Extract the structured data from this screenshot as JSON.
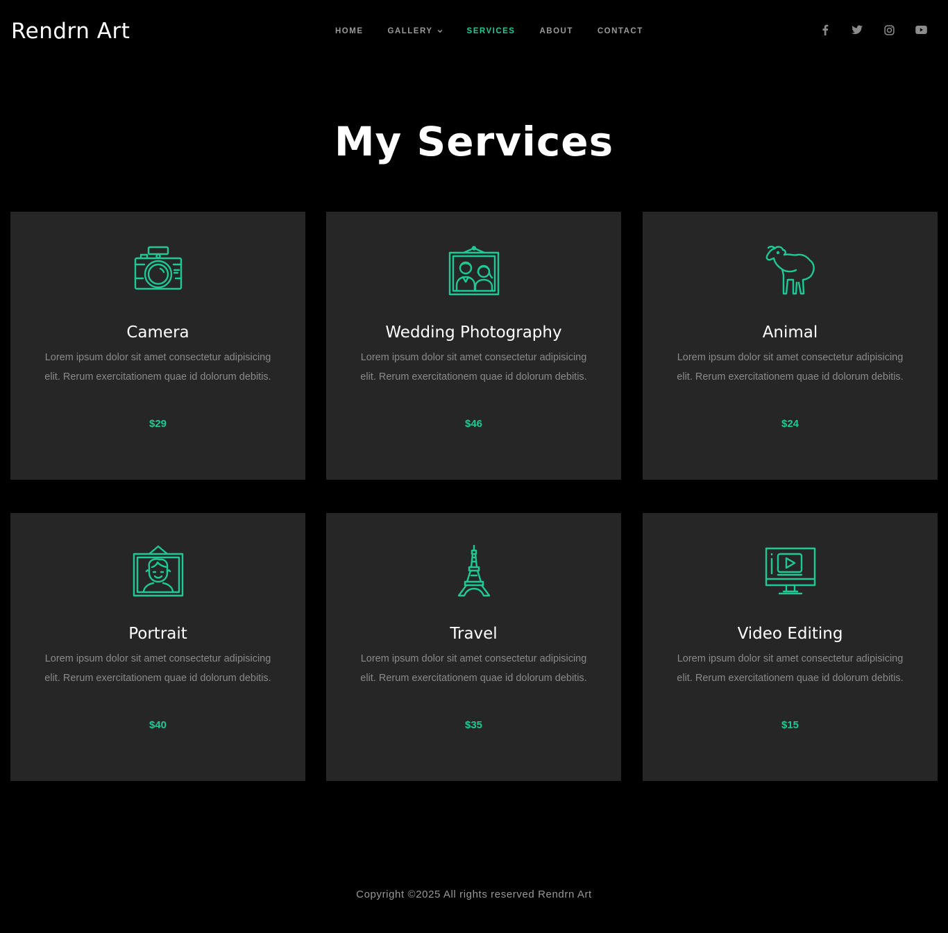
{
  "header": {
    "logo": "Rendrn Art",
    "nav": [
      {
        "label": "HOME",
        "active": false,
        "dropdown": false
      },
      {
        "label": "GALLERY",
        "active": false,
        "dropdown": true
      },
      {
        "label": "SERVICES",
        "active": true,
        "dropdown": false
      },
      {
        "label": "ABOUT",
        "active": false,
        "dropdown": false
      },
      {
        "label": "CONTACT",
        "active": false,
        "dropdown": false
      }
    ],
    "social": [
      "facebook-icon",
      "twitter-icon",
      "instagram-icon",
      "youtube-icon"
    ]
  },
  "main": {
    "title": "My Services",
    "services": [
      {
        "icon": "camera-icon",
        "title": "Camera",
        "desc": "Lorem ipsum dolor sit amet consectetur adipisicing elit. Rerum exercitationem quae id dolorum debitis.",
        "price": "$29"
      },
      {
        "icon": "wedding-photo-icon",
        "title": "Wedding Photography",
        "desc": "Lorem ipsum dolor sit amet consectetur adipisicing elit. Rerum exercitationem quae id dolorum debitis.",
        "price": "$46"
      },
      {
        "icon": "sheep-icon",
        "title": "Animal",
        "desc": "Lorem ipsum dolor sit amet consectetur adipisicing elit. Rerum exercitationem quae id dolorum debitis.",
        "price": "$24"
      },
      {
        "icon": "portrait-frame-icon",
        "title": "Portrait",
        "desc": "Lorem ipsum dolor sit amet consectetur adipisicing elit. Rerum exercitationem quae id dolorum debitis.",
        "price": "$40"
      },
      {
        "icon": "eiffel-tower-icon",
        "title": "Travel",
        "desc": "Lorem ipsum dolor sit amet consectetur adipisicing elit. Rerum exercitationem quae id dolorum debitis.",
        "price": "$35"
      },
      {
        "icon": "video-monitor-icon",
        "title": "Video Editing",
        "desc": "Lorem ipsum dolor sit amet consectetur adipisicing elit. Rerum exercitationem quae id dolorum debitis.",
        "price": "$15"
      }
    ]
  },
  "footer": {
    "copyright": "Copyright ©2025 All rights reserved Rendrn Art"
  },
  "colors": {
    "accent": "#1ec995",
    "card_bg": "#262626",
    "page_bg": "#000000"
  }
}
